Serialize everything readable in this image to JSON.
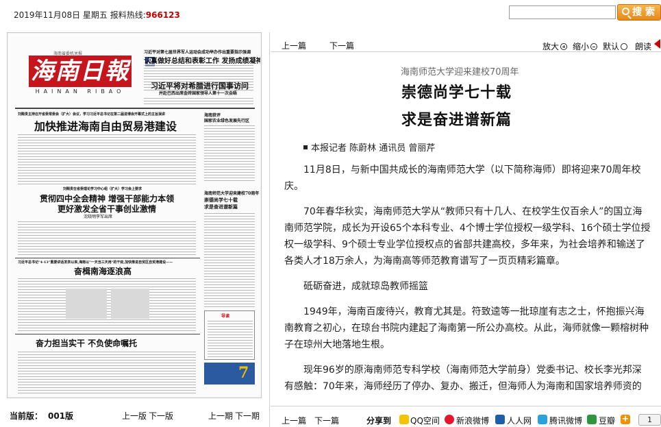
{
  "header": {
    "date": "2019年11月08日 星期五",
    "hotline_label": "报料热线:",
    "hotline_number": "966123",
    "search_button": "搜 索",
    "search_value": ""
  },
  "paper": {
    "masthead": "海南日報",
    "masthead_pinyin": "HAINAN RIBAO",
    "masthead_tag": "海南省委机关报",
    "edition_no": "8",
    "top_headline_1": "习近平对第七届世界军人运动会成功举办作出重要指示强调",
    "top_headline_2": "认真做好总结和表彰工作 发扬成绩凝神聚力",
    "top_headline_3": "习近平将对希腊进行国事访问",
    "top_headline_4": "并赴巴西出席金砖国家领导人第十一次会晤",
    "lead_kicker": "刘赐贵主持召开省委常委会（扩大）会议，学习习近平总书记在第二届进博会开幕式上的主旨演讲",
    "lead_headline": "加快推进海南自由贸易港建设",
    "side_headline_1": "海南获评",
    "side_headline_2": "国家农业绿色发展先行区",
    "mid_kicker": "刘赐贵在省委理论学习中心组（扩大）学习会上要求",
    "mid_headline_1": "贯彻四中全会精神 增强干部能力本领",
    "mid_headline_2": "更好激发全省干事创业激情",
    "mid_sub": "沈晓明李军出席",
    "side_headline_3": "海南师范大学迎来建校70周年",
    "side_headline_4": "崇德尚学七十载",
    "side_headline_5": "求是奋进谱新篇",
    "band_kicker": "习近平总书记\"4·13\"重要讲话发表以来,海南以\"一天当三天用\"的干劲,加快推进自贸区自贸港建设——",
    "band_headline": "奋楫南海逐浪高",
    "bottom_headline": "奋力担当实干 不负使命嘱托",
    "guide_label": "导读",
    "ad_number": "7"
  },
  "left_footer": {
    "current_label": "当前版：",
    "current_value": "001版",
    "prev_edition": "上一版",
    "next_edition": "下一版",
    "prev_issue": "上一期",
    "next_issue": "下一期"
  },
  "toolbar": {
    "prev_article": "上一篇",
    "next_article": "下一篇",
    "zoom_in": "放大",
    "zoom_out": "缩小",
    "default": "默认",
    "read_aloud": "朗读"
  },
  "article": {
    "kicker": "海南师范大学迎来建校70周年",
    "title_line1": "崇德尚学七十载",
    "title_line2": "求是奋进谱新篇",
    "byline": "本报记者 陈蔚林 通讯员 曾丽芹",
    "paragraphs": [
      "11月8日，与新中国共成长的海南师范大学（以下简称海师）即将迎来70周年校庆。",
      "70年春华秋实，海南师范大学从“教师只有十几人、在校学生仅百余人”的国立海南师范学院，成长为开设65个本科专业、4个博士学位授权一级学科、16个硕士学位授权一级学科、9个硕士专业学位授权点的省部共建高校，多年来，为社会培养和输送了各类人才18万余人，为海南高等师范教育谱写了一页页精彩篇章。",
      "砥砺奋进，成就琼岛教师摇篮",
      "1949年，海南百废待兴，教育尤其是。符致逵等一批琼崖有志之士，怀抱振兴海南教育之初心，在琼台书院内建起了海南第一所公办高校。从此，海师就像一颗榕树种子在琼州大地落地生根。",
      "现年96岁的原海南师范专科学校（海南师范大学前身）党委书记、校长李光邦深有感触：70年来，海师经历了停办、复办、搬迁，但海师人为海南和国家培养师资的"
    ]
  },
  "bottom_bar": {
    "prev_article": "上一篇",
    "next_article": "下一篇",
    "share_label": "分享到",
    "share": [
      "QQ空间",
      "新浪微博",
      "人人网",
      "腾讯微博",
      "豆瓣"
    ],
    "page": "1"
  },
  "colors": {
    "accent_red": "#c00000",
    "search_orange": "#f0a030",
    "masthead_red": "#c4161c"
  }
}
